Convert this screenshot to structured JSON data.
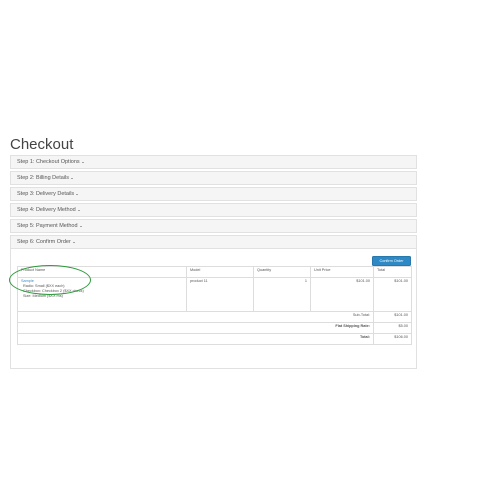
{
  "page": {
    "title": "Checkout"
  },
  "steps": [
    {
      "label": "Step 1: Checkout Options"
    },
    {
      "label": "Step 2: Billing Details"
    },
    {
      "label": "Step 3: Delivery Details"
    },
    {
      "label": "Step 4: Delivery Method"
    },
    {
      "label": "Step 5: Payment Method"
    },
    {
      "label": "Step 6: Confirm Order"
    }
  ],
  "order_table": {
    "headers": [
      "Product Name",
      "Model",
      "Quantity",
      "Unit Price",
      "Total"
    ],
    "rows": [
      {
        "product_name": "Sample",
        "options": [
          "Radio: Small ($XX each)",
          "Checkbox: Checkbox 2 ($XX check)",
          "Size: Medium ($XX ms)"
        ],
        "model": "product 11",
        "quantity": "1",
        "unit_price": "$101.00",
        "total": "$101.00"
      }
    ],
    "totals": [
      {
        "label": "Sub-Total:",
        "value": "$101.00"
      },
      {
        "label": "Flat Shipping Rate:",
        "value": "$5.00"
      },
      {
        "label": "Total:",
        "value": "$106.00"
      }
    ]
  },
  "confirm_button": {
    "label": "Confirm Order"
  },
  "colors": {
    "accent": "#2f89c5",
    "highlight_circle": "#2e9b3c"
  }
}
